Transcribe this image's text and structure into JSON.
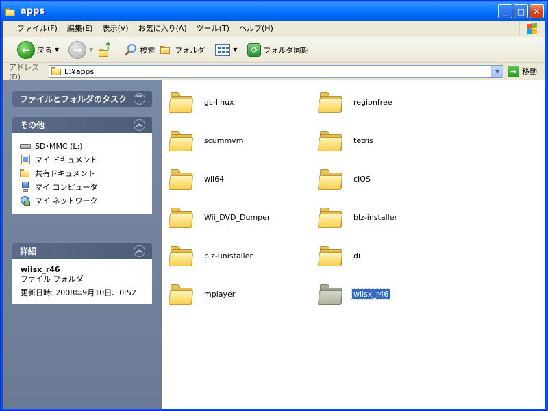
{
  "window": {
    "title": "apps"
  },
  "title_buttons": {
    "minimize": "_",
    "maximize": "□",
    "close": "✕"
  },
  "menubar": {
    "items": [
      "ファイル(F)",
      "編集(E)",
      "表示(V)",
      "お気に入り(A)",
      "ツール(T)",
      "ヘルプ(H)"
    ]
  },
  "toolbar": {
    "back_label": "戻る",
    "search_label": "検索",
    "folders_label": "フォルダ",
    "sync_label": "フォルダ同期"
  },
  "addressbar": {
    "label": "アドレス(D)",
    "value": "L:¥apps",
    "go_label": "移動"
  },
  "taskpane": {
    "file_tasks": {
      "title": "ファイルとフォルダのタスク"
    },
    "other": {
      "title": "その他",
      "links": [
        {
          "label": "SD･MMC (L:)",
          "icon": "drive-icon"
        },
        {
          "label": "マイ ドキュメント",
          "icon": "my-documents-icon"
        },
        {
          "label": "共有ドキュメント",
          "icon": "shared-documents-icon"
        },
        {
          "label": "マイ コンピュータ",
          "icon": "my-computer-icon"
        },
        {
          "label": "マイ ネットワーク",
          "icon": "my-network-icon"
        }
      ]
    },
    "details": {
      "title": "詳細",
      "name": "wiisx_r46",
      "type": "ファイル フォルダ",
      "modified": "更新日時: 2008年9月10日、0:52"
    }
  },
  "files": [
    {
      "name": "gc-linux",
      "selected": false
    },
    {
      "name": "regionfree",
      "selected": false
    },
    {
      "name": "scummvm",
      "selected": false
    },
    {
      "name": "tetris",
      "selected": false
    },
    {
      "name": "wii64",
      "selected": false
    },
    {
      "name": "cIOS",
      "selected": false
    },
    {
      "name": "Wii_DVD_Dumper",
      "selected": false
    },
    {
      "name": "blz-installer",
      "selected": false
    },
    {
      "name": "blz-unistaller",
      "selected": false
    },
    {
      "name": "di",
      "selected": false
    },
    {
      "name": "mplayer",
      "selected": false
    },
    {
      "name": "wiisx_r46",
      "selected": true
    }
  ],
  "colors": {
    "titlebar": "#0054e3",
    "taskpane": "#6b7a95",
    "selection": "#316ac5"
  }
}
